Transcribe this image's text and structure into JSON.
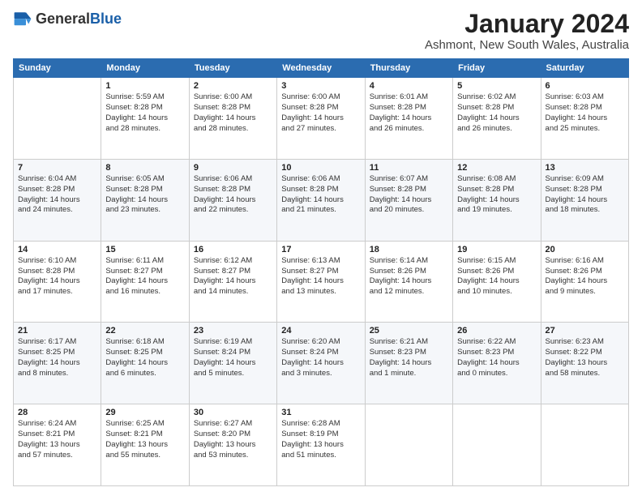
{
  "header": {
    "logo_general": "General",
    "logo_blue": "Blue",
    "month_year": "January 2024",
    "location": "Ashmont, New South Wales, Australia"
  },
  "weekdays": [
    "Sunday",
    "Monday",
    "Tuesday",
    "Wednesday",
    "Thursday",
    "Friday",
    "Saturday"
  ],
  "weeks": [
    [
      {
        "day": "",
        "info": ""
      },
      {
        "day": "1",
        "info": "Sunrise: 5:59 AM\nSunset: 8:28 PM\nDaylight: 14 hours\nand 28 minutes."
      },
      {
        "day": "2",
        "info": "Sunrise: 6:00 AM\nSunset: 8:28 PM\nDaylight: 14 hours\nand 28 minutes."
      },
      {
        "day": "3",
        "info": "Sunrise: 6:00 AM\nSunset: 8:28 PM\nDaylight: 14 hours\nand 27 minutes."
      },
      {
        "day": "4",
        "info": "Sunrise: 6:01 AM\nSunset: 8:28 PM\nDaylight: 14 hours\nand 26 minutes."
      },
      {
        "day": "5",
        "info": "Sunrise: 6:02 AM\nSunset: 8:28 PM\nDaylight: 14 hours\nand 26 minutes."
      },
      {
        "day": "6",
        "info": "Sunrise: 6:03 AM\nSunset: 8:28 PM\nDaylight: 14 hours\nand 25 minutes."
      }
    ],
    [
      {
        "day": "7",
        "info": "Sunrise: 6:04 AM\nSunset: 8:28 PM\nDaylight: 14 hours\nand 24 minutes."
      },
      {
        "day": "8",
        "info": "Sunrise: 6:05 AM\nSunset: 8:28 PM\nDaylight: 14 hours\nand 23 minutes."
      },
      {
        "day": "9",
        "info": "Sunrise: 6:06 AM\nSunset: 8:28 PM\nDaylight: 14 hours\nand 22 minutes."
      },
      {
        "day": "10",
        "info": "Sunrise: 6:06 AM\nSunset: 8:28 PM\nDaylight: 14 hours\nand 21 minutes."
      },
      {
        "day": "11",
        "info": "Sunrise: 6:07 AM\nSunset: 8:28 PM\nDaylight: 14 hours\nand 20 minutes."
      },
      {
        "day": "12",
        "info": "Sunrise: 6:08 AM\nSunset: 8:28 PM\nDaylight: 14 hours\nand 19 minutes."
      },
      {
        "day": "13",
        "info": "Sunrise: 6:09 AM\nSunset: 8:28 PM\nDaylight: 14 hours\nand 18 minutes."
      }
    ],
    [
      {
        "day": "14",
        "info": "Sunrise: 6:10 AM\nSunset: 8:28 PM\nDaylight: 14 hours\nand 17 minutes."
      },
      {
        "day": "15",
        "info": "Sunrise: 6:11 AM\nSunset: 8:27 PM\nDaylight: 14 hours\nand 16 minutes."
      },
      {
        "day": "16",
        "info": "Sunrise: 6:12 AM\nSunset: 8:27 PM\nDaylight: 14 hours\nand 14 minutes."
      },
      {
        "day": "17",
        "info": "Sunrise: 6:13 AM\nSunset: 8:27 PM\nDaylight: 14 hours\nand 13 minutes."
      },
      {
        "day": "18",
        "info": "Sunrise: 6:14 AM\nSunset: 8:26 PM\nDaylight: 14 hours\nand 12 minutes."
      },
      {
        "day": "19",
        "info": "Sunrise: 6:15 AM\nSunset: 8:26 PM\nDaylight: 14 hours\nand 10 minutes."
      },
      {
        "day": "20",
        "info": "Sunrise: 6:16 AM\nSunset: 8:26 PM\nDaylight: 14 hours\nand 9 minutes."
      }
    ],
    [
      {
        "day": "21",
        "info": "Sunrise: 6:17 AM\nSunset: 8:25 PM\nDaylight: 14 hours\nand 8 minutes."
      },
      {
        "day": "22",
        "info": "Sunrise: 6:18 AM\nSunset: 8:25 PM\nDaylight: 14 hours\nand 6 minutes."
      },
      {
        "day": "23",
        "info": "Sunrise: 6:19 AM\nSunset: 8:24 PM\nDaylight: 14 hours\nand 5 minutes."
      },
      {
        "day": "24",
        "info": "Sunrise: 6:20 AM\nSunset: 8:24 PM\nDaylight: 14 hours\nand 3 minutes."
      },
      {
        "day": "25",
        "info": "Sunrise: 6:21 AM\nSunset: 8:23 PM\nDaylight: 14 hours\nand 1 minute."
      },
      {
        "day": "26",
        "info": "Sunrise: 6:22 AM\nSunset: 8:23 PM\nDaylight: 14 hours\nand 0 minutes."
      },
      {
        "day": "27",
        "info": "Sunrise: 6:23 AM\nSunset: 8:22 PM\nDaylight: 13 hours\nand 58 minutes."
      }
    ],
    [
      {
        "day": "28",
        "info": "Sunrise: 6:24 AM\nSunset: 8:21 PM\nDaylight: 13 hours\nand 57 minutes."
      },
      {
        "day": "29",
        "info": "Sunrise: 6:25 AM\nSunset: 8:21 PM\nDaylight: 13 hours\nand 55 minutes."
      },
      {
        "day": "30",
        "info": "Sunrise: 6:27 AM\nSunset: 8:20 PM\nDaylight: 13 hours\nand 53 minutes."
      },
      {
        "day": "31",
        "info": "Sunrise: 6:28 AM\nSunset: 8:19 PM\nDaylight: 13 hours\nand 51 minutes."
      },
      {
        "day": "",
        "info": ""
      },
      {
        "day": "",
        "info": ""
      },
      {
        "day": "",
        "info": ""
      }
    ]
  ]
}
